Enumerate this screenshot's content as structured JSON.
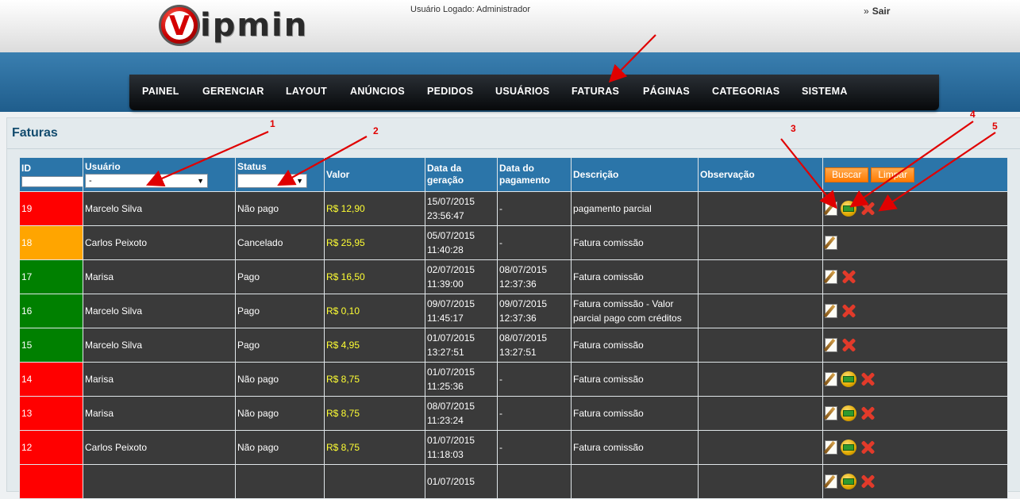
{
  "header": {
    "logo_text": "ipmin",
    "logo_initial": "V",
    "user_logged": "Usuário Logado: Administrador",
    "logout_label": "Sair"
  },
  "nav": {
    "items": [
      "PAINEL",
      "GERENCIAR",
      "LAYOUT",
      "ANÚNCIOS",
      "PEDIDOS",
      "USUÁRIOS",
      "FATURAS",
      "PÁGINAS",
      "CATEGORIAS",
      "SISTEMA"
    ]
  },
  "page": {
    "title": "Faturas"
  },
  "table": {
    "headers": {
      "id": "ID",
      "usuario": "Usuário",
      "status": "Status",
      "valor": "Valor",
      "data_geracao": "Data da geração",
      "data_pagamento": "Data do pagamento",
      "descricao": "Descrição",
      "observacao": "Observação"
    },
    "filters": {
      "usuario_selected": "-",
      "status_selected": ""
    },
    "buttons": {
      "search": "Buscar",
      "clear": "Limpar"
    },
    "rows": [
      {
        "id": "19",
        "usuario": "Marcelo Silva",
        "status": "Não pago",
        "valor": "R$ 12,90",
        "data_geracao": "15/07/2015 23:56:47",
        "data_pagamento": "-",
        "descricao": "pagamento parcial",
        "observacao": "",
        "id_color": "#ff0000",
        "actions": [
          "edit",
          "pay",
          "delete"
        ]
      },
      {
        "id": "18",
        "usuario": "Carlos Peixoto",
        "status": "Cancelado",
        "valor": "R$ 25,95",
        "data_geracao": "05/07/2015 11:40:28",
        "data_pagamento": "-",
        "descricao": "Fatura comissão",
        "observacao": "",
        "id_color": "#ffa500",
        "actions": [
          "edit"
        ]
      },
      {
        "id": "17",
        "usuario": "Marisa",
        "status": "Pago",
        "valor": "R$ 16,50",
        "data_geracao": "02/07/2015 11:39:00",
        "data_pagamento": "08/07/2015 12:37:36",
        "descricao": "Fatura comissão",
        "observacao": "",
        "id_color": "#008000",
        "actions": [
          "edit",
          "delete"
        ]
      },
      {
        "id": "16",
        "usuario": "Marcelo Silva",
        "status": "Pago",
        "valor": "R$ 0,10",
        "data_geracao": "09/07/2015 11:45:17",
        "data_pagamento": "09/07/2015 12:37:36",
        "descricao": "Fatura comissão - Valor parcial pago com créditos",
        "observacao": "",
        "id_color": "#008000",
        "actions": [
          "edit",
          "delete"
        ]
      },
      {
        "id": "15",
        "usuario": "Marcelo Silva",
        "status": "Pago",
        "valor": "R$ 4,95",
        "data_geracao": "01/07/2015 13:27:51",
        "data_pagamento": "08/07/2015 13:27:51",
        "descricao": "Fatura comissão",
        "observacao": "",
        "id_color": "#008000",
        "actions": [
          "edit",
          "delete"
        ]
      },
      {
        "id": "14",
        "usuario": "Marisa",
        "status": "Não pago",
        "valor": "R$ 8,75",
        "data_geracao": "01/07/2015 11:25:36",
        "data_pagamento": "-",
        "descricao": "Fatura comissão",
        "observacao": "",
        "id_color": "#ff0000",
        "actions": [
          "edit",
          "pay",
          "delete"
        ]
      },
      {
        "id": "13",
        "usuario": "Marisa",
        "status": "Não pago",
        "valor": "R$ 8,75",
        "data_geracao": "08/07/2015 11:23:24",
        "data_pagamento": "-",
        "descricao": "Fatura comissão",
        "observacao": "",
        "id_color": "#ff0000",
        "actions": [
          "edit",
          "pay",
          "delete"
        ]
      },
      {
        "id": "12",
        "usuario": "Carlos Peixoto",
        "status": "Não pago",
        "valor": "R$ 8,75",
        "data_geracao": "01/07/2015 11:18:03",
        "data_pagamento": "-",
        "descricao": "Fatura comissão",
        "observacao": "",
        "id_color": "#ff0000",
        "actions": [
          "edit",
          "pay",
          "delete"
        ]
      },
      {
        "id": "",
        "usuario": "",
        "status": "",
        "valor": "",
        "data_geracao": "01/07/2015",
        "data_pagamento": "",
        "descricao": "",
        "observacao": "",
        "id_color": "#ff0000",
        "actions": [
          "edit",
          "pay",
          "delete"
        ]
      }
    ]
  },
  "annotations": {
    "labels": [
      "1",
      "2",
      "3",
      "4",
      "5"
    ],
    "color": "#e00000"
  }
}
